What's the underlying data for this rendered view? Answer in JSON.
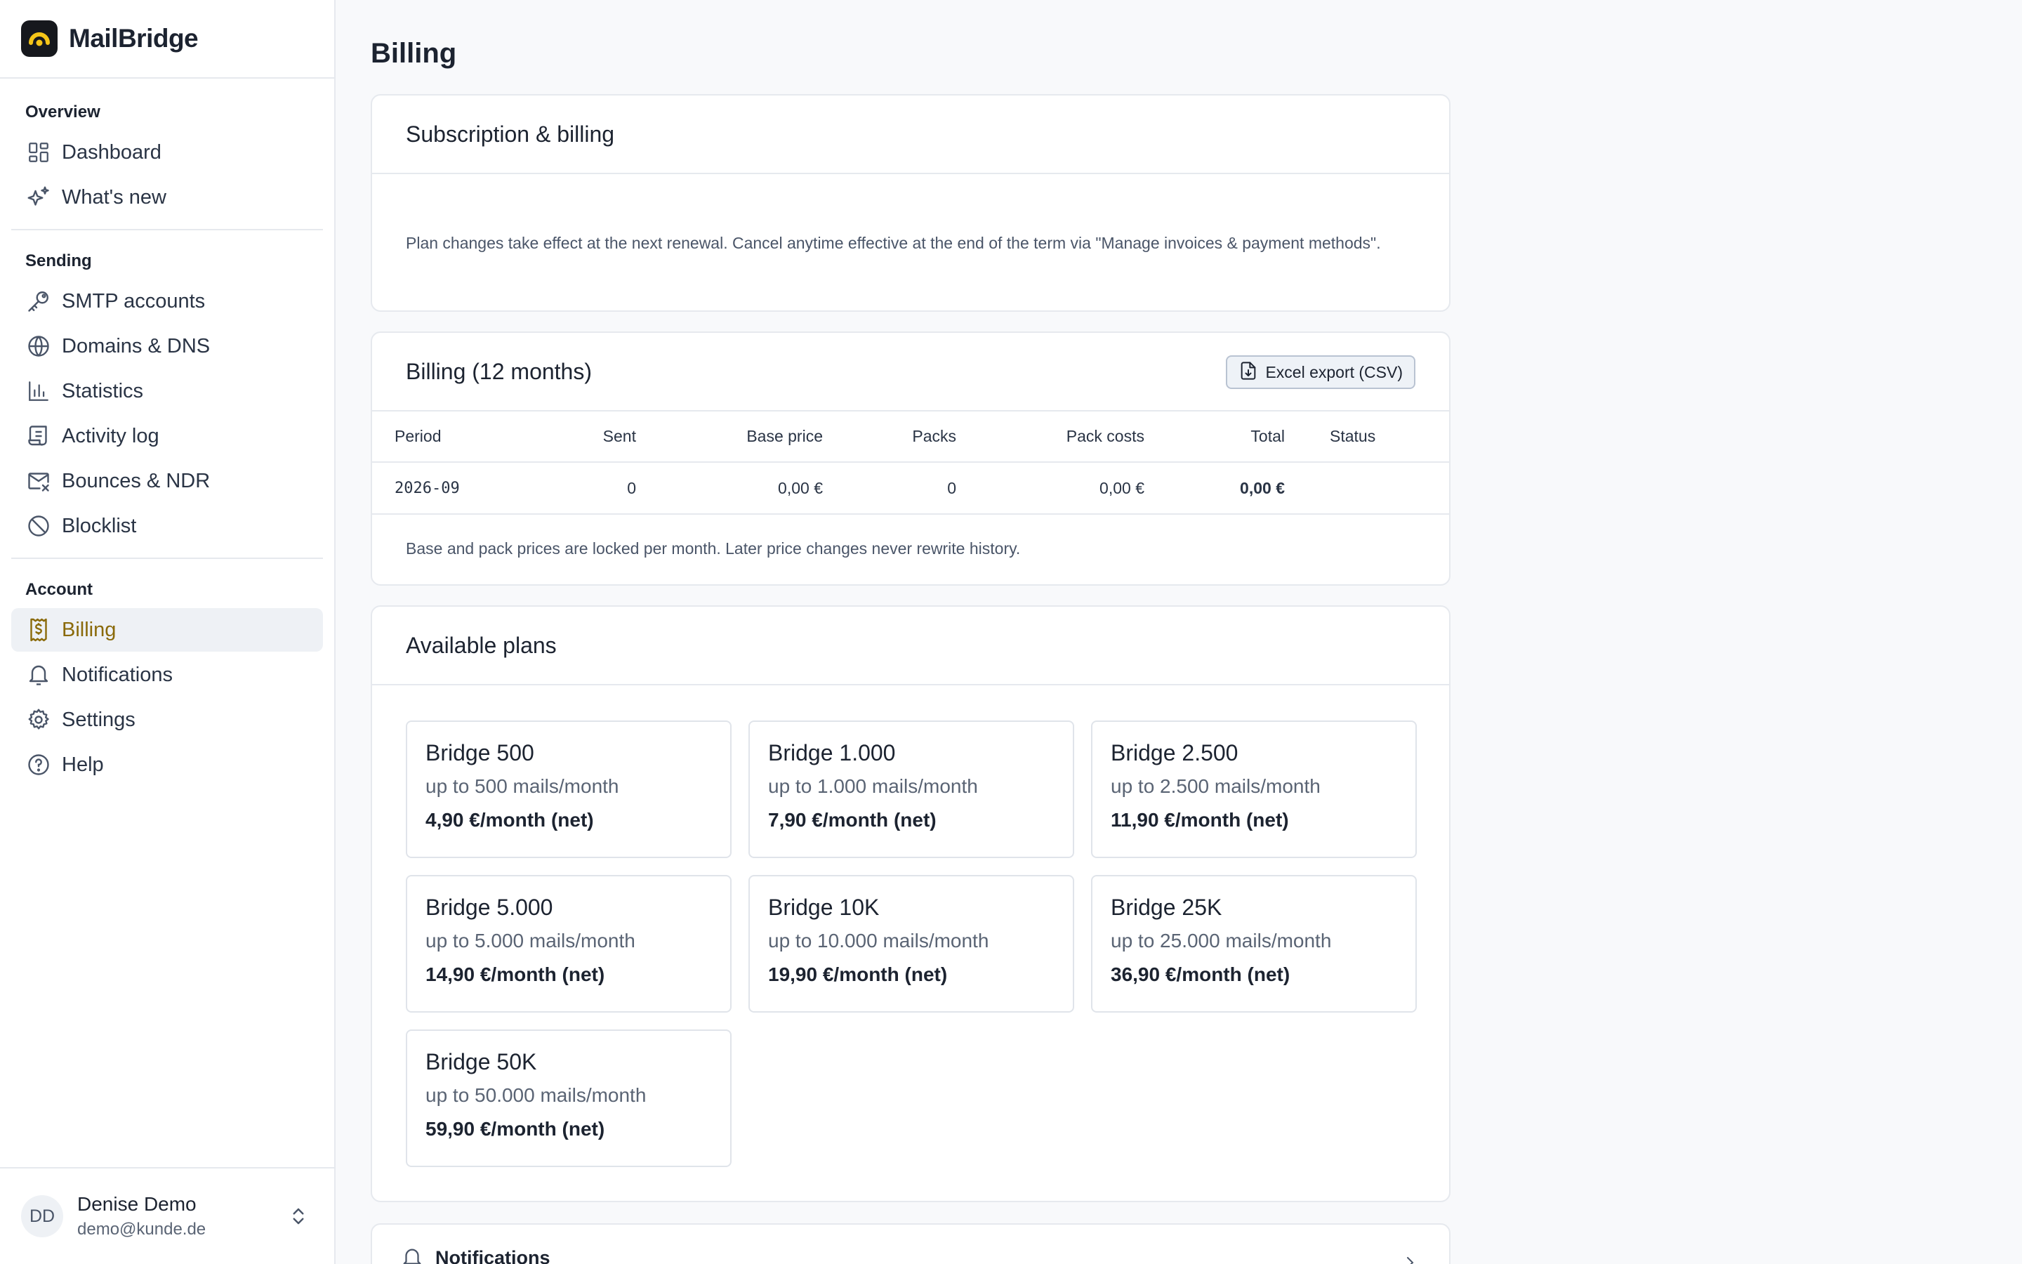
{
  "brand": {
    "name": "MailBridge"
  },
  "sidebar": {
    "sections": [
      {
        "label": "Overview",
        "items": [
          {
            "label": "Dashboard",
            "icon": "dashboard-icon"
          },
          {
            "label": "What's new",
            "icon": "sparkles-icon"
          }
        ]
      },
      {
        "label": "Sending",
        "items": [
          {
            "label": "SMTP accounts",
            "icon": "key-icon"
          },
          {
            "label": "Domains & DNS",
            "icon": "globe-icon"
          },
          {
            "label": "Statistics",
            "icon": "bar-chart-icon"
          },
          {
            "label": "Activity log",
            "icon": "scroll-icon"
          },
          {
            "label": "Bounces & NDR",
            "icon": "mail-x-icon"
          },
          {
            "label": "Blocklist",
            "icon": "ban-icon"
          }
        ]
      },
      {
        "label": "Account",
        "items": [
          {
            "label": "Billing",
            "icon": "billing-icon",
            "active": true
          },
          {
            "label": "Notifications",
            "icon": "bell-icon"
          },
          {
            "label": "Settings",
            "icon": "gear-icon"
          },
          {
            "label": "Help",
            "icon": "help-icon"
          }
        ]
      }
    ],
    "user": {
      "initials": "DD",
      "name": "Denise Demo",
      "email": "demo@kunde.de"
    }
  },
  "page": {
    "title": "Billing"
  },
  "subscription": {
    "title": "Subscription & billing",
    "note": "Plan changes take effect at the next renewal. Cancel anytime effective at the end of the term via \"Manage invoices & payment methods\"."
  },
  "billing": {
    "title": "Billing (12 months)",
    "export_label": "Excel export (CSV)",
    "columns": [
      "Period",
      "Sent",
      "Base price",
      "Packs",
      "Pack costs",
      "Total",
      "Status"
    ],
    "rows": [
      {
        "period": "2026-09",
        "sent": "0",
        "base_price": "0,00 €",
        "packs": "0",
        "pack_costs": "0,00 €",
        "total": "0,00 €",
        "status": ""
      }
    ],
    "footnote": "Base and pack prices are locked per month. Later price changes never rewrite history."
  },
  "plans": {
    "title": "Available plans",
    "items": [
      {
        "name": "Bridge 500",
        "limit": "up to 500 mails/month",
        "price": "4,90 €/month (net)"
      },
      {
        "name": "Bridge 1.000",
        "limit": "up to 1.000 mails/month",
        "price": "7,90 €/month (net)"
      },
      {
        "name": "Bridge 2.500",
        "limit": "up to 2.500 mails/month",
        "price": "11,90 €/month (net)"
      },
      {
        "name": "Bridge 5.000",
        "limit": "up to 5.000 mails/month",
        "price": "14,90 €/month (net)"
      },
      {
        "name": "Bridge 10K",
        "limit": "up to 10.000 mails/month",
        "price": "19,90 €/month (net)"
      },
      {
        "name": "Bridge 25K",
        "limit": "up to 25.000 mails/month",
        "price": "36,90 €/month (net)"
      },
      {
        "name": "Bridge 50K",
        "limit": "up to 50.000 mails/month",
        "price": "59,90 €/month (net)"
      }
    ]
  },
  "notifications_card": {
    "title": "Notifications"
  },
  "colors": {
    "accent": "#8a6a0a",
    "brand_dark": "#16181d",
    "logo_yellow": "#f5c518"
  }
}
